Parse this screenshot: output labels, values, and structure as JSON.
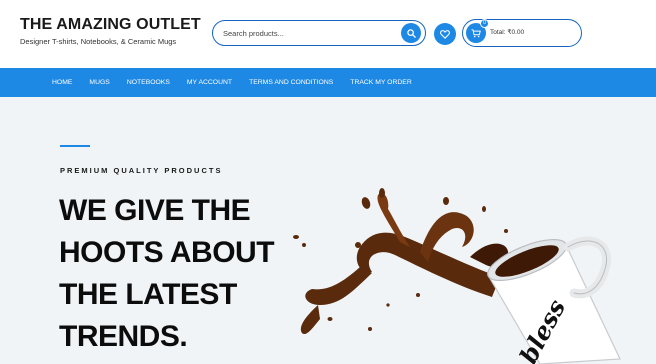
{
  "brand": {
    "title": "THE AMAZING OUTLET",
    "tagline": "Designer T-shirts, Notebooks, & Ceramic Mugs"
  },
  "search": {
    "placeholder": "Search products...",
    "icon": "search-icon"
  },
  "wishlist": {
    "icon": "heart-icon"
  },
  "cart": {
    "icon": "cart-icon",
    "count": "0",
    "total": "Total: ₹0.00"
  },
  "nav": {
    "items": [
      "HOME",
      "MUGS",
      "NOTEBOOKS",
      "MY ACCOUNT",
      "TERMS AND CONDITIONS",
      "TRACK MY ORDER"
    ]
  },
  "hero": {
    "eyebrow": "PREMIUM QUALITY PRODUCTS",
    "headline": [
      "WE GIVE THE",
      "HOOTS ABOUT",
      "THE LATEST",
      "TRENDS."
    ],
    "mug_text": "bless"
  },
  "colors": {
    "primary": "#1e88e5",
    "border": "#1565c0",
    "hero_bg": "#f1f4f6",
    "coffee": "#5a2a0c"
  }
}
